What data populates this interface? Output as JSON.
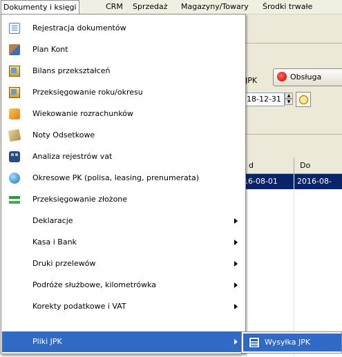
{
  "menubar": {
    "items": [
      {
        "label": "Dokumenty i księgi"
      },
      {
        "label": "CRM"
      },
      {
        "label": "Sprzedaż"
      },
      {
        "label": "Magazyny/Towary"
      },
      {
        "label": "Środki trwałe"
      }
    ]
  },
  "background": {
    "jpk_fragment": "JPK",
    "obsluga_label": "Obsługa",
    "date_value": "18-12-31",
    "grid": {
      "col1_header": "d",
      "col2_header": "Do",
      "row_col1": "16-08-01",
      "row_col2": "2016-08-"
    }
  },
  "menu": {
    "items": [
      {
        "label": "Rejestracja dokumentów",
        "icon": "document-icon"
      },
      {
        "label": "Plan Kont",
        "icon": "plan-icon"
      },
      {
        "label": "Bilans przekształceń",
        "icon": "balance-icon"
      },
      {
        "label": "Przeksięgowanie roku/okresu",
        "icon": "transfer-icon"
      },
      {
        "label": "Wiekowanie rozrachunków",
        "icon": "aging-icon"
      },
      {
        "label": "Noty Odsetkowe",
        "icon": "interest-notes-icon"
      },
      {
        "label": "Analiza rejestrów vat",
        "icon": "binoculars-icon"
      },
      {
        "label": "Okresowe PK (polisa, leasing, prenumerata)",
        "icon": "globe-icon"
      },
      {
        "label": "Przeksięgowanie złożone",
        "icon": "complex-transfer-icon"
      },
      {
        "label": "Deklaracje"
      },
      {
        "label": "Kasa i Bank"
      },
      {
        "label": "Druki przelewów"
      },
      {
        "label": "Podróże służbowe, kilometrówka"
      },
      {
        "label": "Korekty podatkowe i VAT"
      },
      {
        "label": "Pliki JPK"
      }
    ]
  },
  "submenu": {
    "label": "Wysyłka JPK",
    "icon": "send-jpk-icon"
  },
  "colors": {
    "highlight": "#316ac5",
    "selected_row": "#0a246a"
  }
}
